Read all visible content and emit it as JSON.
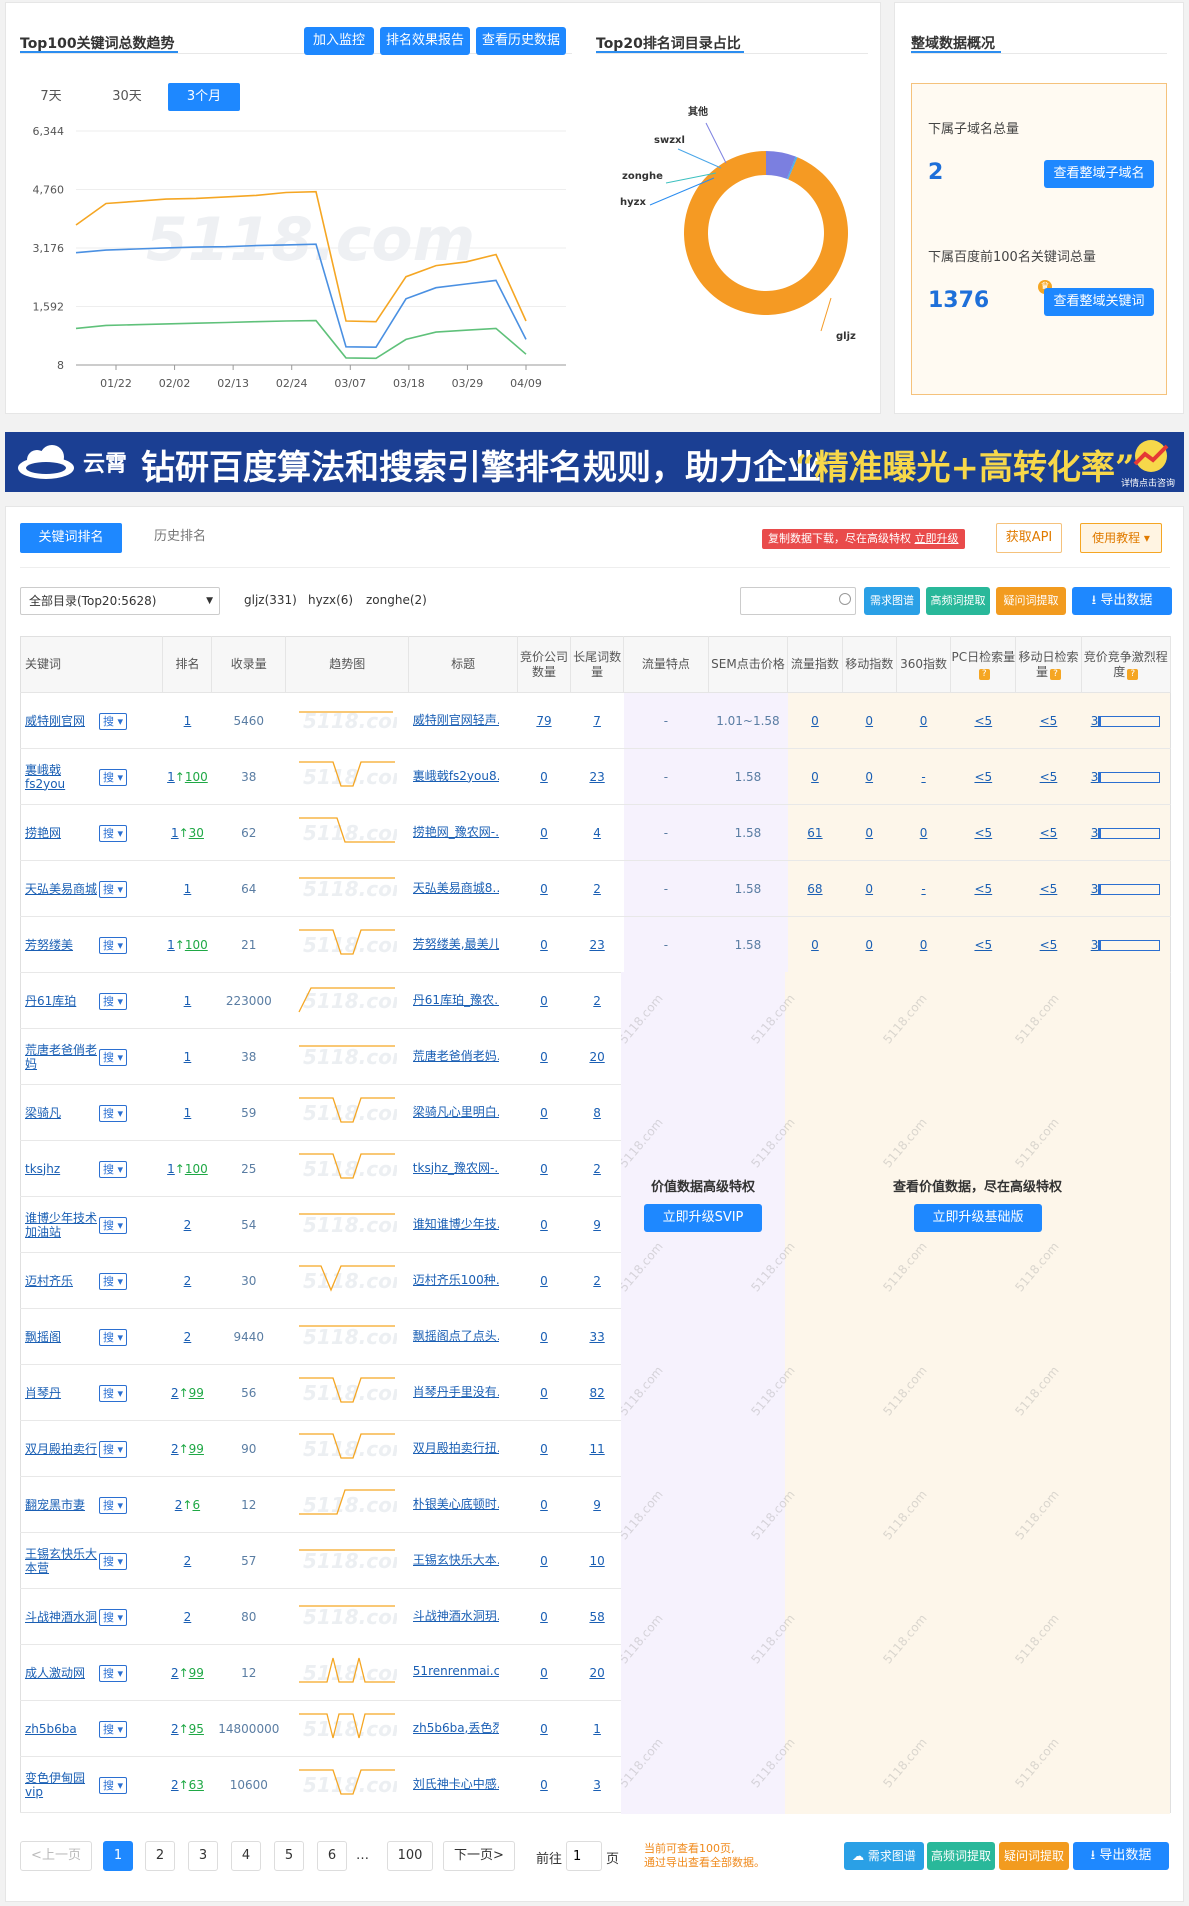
{
  "trend_card": {
    "title": "Top100关键词总数趋势",
    "buttons": [
      "加入监控",
      "排名效果报告",
      "查看历史数据"
    ],
    "ranges": [
      "7天",
      "30天",
      "3个月"
    ],
    "active_range": "3个月",
    "watermark": "5118.com"
  },
  "chart_data": [
    {
      "type": "line",
      "title": "",
      "x": [
        "01/22",
        "02/02",
        "02/13",
        "02/24",
        "03/07",
        "03/18",
        "03/29",
        "04/09"
      ],
      "yticks": [
        "6,344",
        "4,760",
        "3,176",
        "1,592",
        "8"
      ],
      "ylim": [
        8,
        6344
      ],
      "grid": true,
      "series": [
        {
          "color": "#f5a623",
          "values": [
            3800,
            4380,
            4440,
            4500,
            4520,
            4560,
            4600,
            4680,
            4700,
            1200,
            1180,
            2400,
            2700,
            2800,
            3000,
            1200
          ]
        },
        {
          "color": "#4a90e2",
          "values": [
            3050,
            3120,
            3150,
            3180,
            3200,
            3210,
            3240,
            3260,
            3280,
            500,
            490,
            1800,
            2100,
            2200,
            2300,
            700
          ]
        },
        {
          "color": "#5fc17a",
          "values": [
            1000,
            1080,
            1100,
            1120,
            1140,
            1160,
            1180,
            1200,
            1210,
            200,
            190,
            700,
            900,
            950,
            1000,
            300
          ]
        }
      ]
    },
    {
      "type": "pie",
      "title": "Top20排名词目录占比",
      "labels": [
        "其他",
        "swzxl",
        "zonghe",
        "hyzx",
        "gljz"
      ],
      "values": [
        331,
        12,
        4,
        6,
        5275
      ],
      "colors": [
        "#7b7fe0",
        "#4aa6e8",
        "#3cc0c0",
        "#2b8df0",
        "#f59a23"
      ],
      "donut": true
    }
  ],
  "overview": {
    "title": "整域数据概况",
    "subdomain_label": "下属子域名总量",
    "subdomain_value": "2",
    "subdomain_button": "查看整域子域名",
    "keyword_label": "下属百度前100名关键词总量",
    "keyword_value": "1376",
    "keyword_button": "查看整域关键词"
  },
  "banner": {
    "brand": "云霄",
    "text": "钻研百度算法和搜索引擎排名规则，助力企业",
    "highlight": "“精准曝光+高转化率”",
    "detail": "详情点击咨询",
    "bg": "#1b3f93"
  },
  "keyword_panel": {
    "tabs": [
      "关键词排名",
      "历史排名"
    ],
    "active_tab": "关键词排名",
    "notice_text": "复制数据下载，尽在高级特权",
    "notice_link": "立即升级",
    "api_button": "获取API",
    "tutorial_button": "使用教程",
    "category_select": "全部目录(Top20:5628)",
    "categories": [
      "gljz(331)",
      "hyzx(6)",
      "zonghe(2)"
    ],
    "search_placeholder": "",
    "tool_buttons": [
      "需求图谱",
      "高频词提取",
      "疑问词提取"
    ],
    "export_button": "导出数据",
    "columns": [
      "关键词",
      "排名",
      "收录量",
      "趋势图",
      "标题",
      "竞价公司数量",
      "长尾词数量",
      "流量特点",
      "SEM点击价格",
      "流量指数",
      "移动指数",
      "360指数",
      "PC日检索量",
      "移动日检索量",
      "竞价竞争激烈程度"
    ],
    "rows": [
      {
        "kw": "威特刚官网",
        "rank": "1",
        "delta": "",
        "index": "5460",
        "title": "威特刚官网轻声…",
        "bid": "79",
        "long": "7",
        "flow": "-",
        "sem": "1.01~1.58",
        "fi": "0",
        "mi": "0",
        "i360": "0",
        "pc": "<5",
        "mob": "<5",
        "comp": "3"
      },
      {
        "kw": "裏峨戟fs2you",
        "rank": "1",
        "delta": "100",
        "index": "38",
        "title": "裏峨戟fs2you8…",
        "bid": "0",
        "long": "23",
        "flow": "-",
        "sem": "1.58",
        "fi": "0",
        "mi": "0",
        "i360": "-",
        "pc": "<5",
        "mob": "<5",
        "comp": "3"
      },
      {
        "kw": "捞艳网",
        "rank": "1",
        "delta": "30",
        "index": "62",
        "title": "捞艳网_豫农网-…",
        "bid": "0",
        "long": "4",
        "flow": "-",
        "sem": "1.58",
        "fi": "61",
        "mi": "0",
        "i360": "0",
        "pc": "<5",
        "mob": "<5",
        "comp": "3"
      },
      {
        "kw": "天弘美易商城",
        "rank": "1",
        "delta": "",
        "index": "64",
        "title": "天弘美易商城8…",
        "bid": "0",
        "long": "2",
        "flow": "-",
        "sem": "1.58",
        "fi": "68",
        "mi": "0",
        "i360": "-",
        "pc": "<5",
        "mob": "<5",
        "comp": "3"
      },
      {
        "kw": "芳努缕美",
        "rank": "1",
        "delta": "100",
        "index": "21",
        "title": "芳努缕美,最美儿…",
        "bid": "0",
        "long": "23",
        "flow": "-",
        "sem": "1.58",
        "fi": "0",
        "mi": "0",
        "i360": "0",
        "pc": "<5",
        "mob": "<5",
        "comp": "3"
      },
      {
        "kw": "丹61库珀",
        "rank": "1",
        "delta": "",
        "index": "223000",
        "title": "丹61库珀_豫农…",
        "bid": "0",
        "long": "2"
      },
      {
        "kw": "荒唐老爸俏老妈",
        "rank": "1",
        "delta": "",
        "index": "38",
        "title": "荒唐老爸俏老妈…",
        "bid": "0",
        "long": "20"
      },
      {
        "kw": "梁骑凡",
        "rank": "1",
        "delta": "",
        "index": "59",
        "title": "梁骑凡心里明白…",
        "bid": "0",
        "long": "8"
      },
      {
        "kw": "tksjhz",
        "rank": "1",
        "delta": "100",
        "index": "25",
        "title": "tksjhz_豫农网-…",
        "bid": "0",
        "long": "2"
      },
      {
        "kw": "谁博少年技术加油站",
        "rank": "2",
        "delta": "",
        "index": "54",
        "title": "谁知谁博少年技…",
        "bid": "0",
        "long": "9"
      },
      {
        "kw": "迈村齐乐",
        "rank": "2",
        "delta": "",
        "index": "30",
        "title": "迈村齐乐100种…",
        "bid": "0",
        "long": "2"
      },
      {
        "kw": "飘摇阁",
        "rank": "2",
        "delta": "",
        "index": "9440",
        "title": "飘摇阁点了点头…",
        "bid": "0",
        "long": "33"
      },
      {
        "kw": "肖琴丹",
        "rank": "2",
        "delta": "99",
        "index": "56",
        "title": "肖琴丹手里没有…",
        "bid": "0",
        "long": "82"
      },
      {
        "kw": "双月殿拍卖行",
        "rank": "2",
        "delta": "99",
        "index": "90",
        "title": "双月殿拍卖行扭…",
        "bid": "0",
        "long": "11"
      },
      {
        "kw": "翻宠黑市妻",
        "rank": "2",
        "delta": "6",
        "index": "12",
        "title": "朴银美心底顿时…",
        "bid": "0",
        "long": "9"
      },
      {
        "kw": "王锡玄快乐大本营",
        "rank": "2",
        "delta": "",
        "index": "57",
        "title": "王锡玄快乐大本…",
        "bid": "0",
        "long": "10"
      },
      {
        "kw": "斗战神酒水洞",
        "rank": "2",
        "delta": "",
        "index": "80",
        "title": "斗战神酒水洞玥…",
        "bid": "0",
        "long": "58"
      },
      {
        "kw": "成人激动网",
        "rank": "2",
        "delta": "99",
        "index": "12",
        "title": "51renrenmai.co…",
        "bid": "0",
        "long": "20"
      },
      {
        "kw": "zh5b6ba",
        "rank": "2",
        "delta": "95",
        "index": "14800000",
        "title": "zh5b6ba,丢色烈…",
        "bid": "0",
        "long": "1"
      },
      {
        "kw": "变色伊甸园vip",
        "rank": "2",
        "delta": "63",
        "index": "10600",
        "title": "刘氏神卡心中感…",
        "bid": "0",
        "long": "3"
      }
    ],
    "svip_text": "价值数据高级特权",
    "svip_button": "立即升级SVIP",
    "basic_text": "查看价值数据，尽在高级特权",
    "basic_button": "立即升级基础版",
    "search_btn": "搜"
  },
  "pagination": {
    "prev": "<上一页",
    "pages": [
      "1",
      "2",
      "3",
      "4",
      "5",
      "6"
    ],
    "ellipsis": "…",
    "last": "100",
    "next": "下一页>",
    "goto_label": "前往",
    "goto_value": "1",
    "page_unit": "页",
    "note_line1": "当前可查看100页,",
    "note_line2": "通过导出查看全部数据。"
  }
}
